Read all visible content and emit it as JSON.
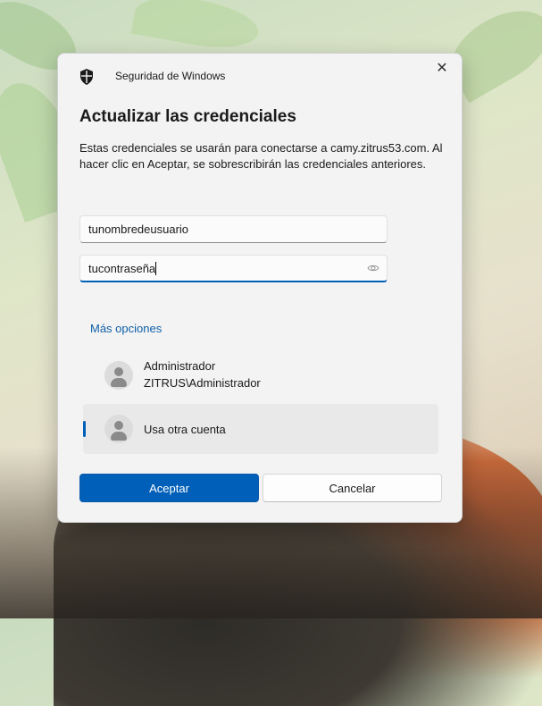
{
  "window": {
    "title": "Seguridad de Windows"
  },
  "dialog": {
    "heading": "Actualizar las credenciales",
    "description": "Estas credenciales se usarán para conectarse a camy.zitrus53.com. Al hacer clic en Aceptar, se sobrescribirán las credenciales anteriores.",
    "username_value": "tunombredeusuario",
    "password_value": "tucontraseña",
    "more_options": "Más opciones",
    "accounts": [
      {
        "line1": "Administrador",
        "line2": "ZITRUS\\Administrador"
      },
      {
        "line1": "Usa otra cuenta"
      }
    ],
    "ok_label": "Aceptar",
    "cancel_label": "Cancelar"
  },
  "colors": {
    "accent": "#005fb8",
    "link": "#0f5fa8",
    "dialog_bg": "#f3f3f3"
  },
  "icons": [
    "shield-icon",
    "close-icon",
    "eye-icon",
    "user-avatar-icon"
  ]
}
